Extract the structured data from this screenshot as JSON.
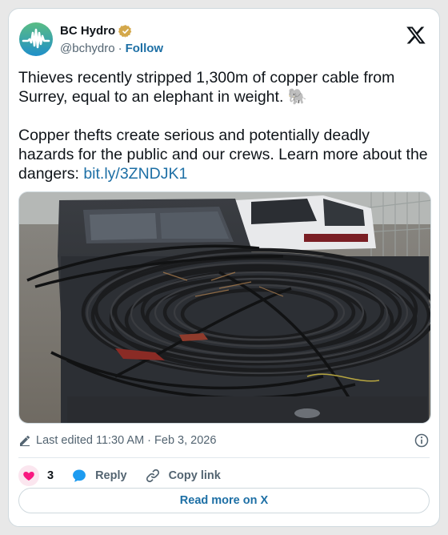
{
  "account": {
    "name": "BC Hydro",
    "handle": "@bchydro",
    "separator": "·",
    "follow_label": "Follow"
  },
  "tweet": {
    "para1": "Thieves recently stripped 1,300m of copper cable from Surrey, equal to an elephant in weight. 🐘",
    "para2_text": "Copper thefts create serious and potentially deadly hazards for the public and our crews. Learn more about the dangers: ",
    "para2_link": "bit.ly/3ZNDJK1"
  },
  "meta": {
    "edited": "Last edited 11:30 AM · Feb 3, 2026"
  },
  "actions": {
    "likes": "3",
    "reply_label": "Reply",
    "copy_label": "Copy link"
  },
  "read_more_label": "Read more on X",
  "colors": {
    "link": "#1d6fa5",
    "heart": "#f91880",
    "reply_icon": "#1d9bf0",
    "avatar_ring": "#5bbd84"
  }
}
